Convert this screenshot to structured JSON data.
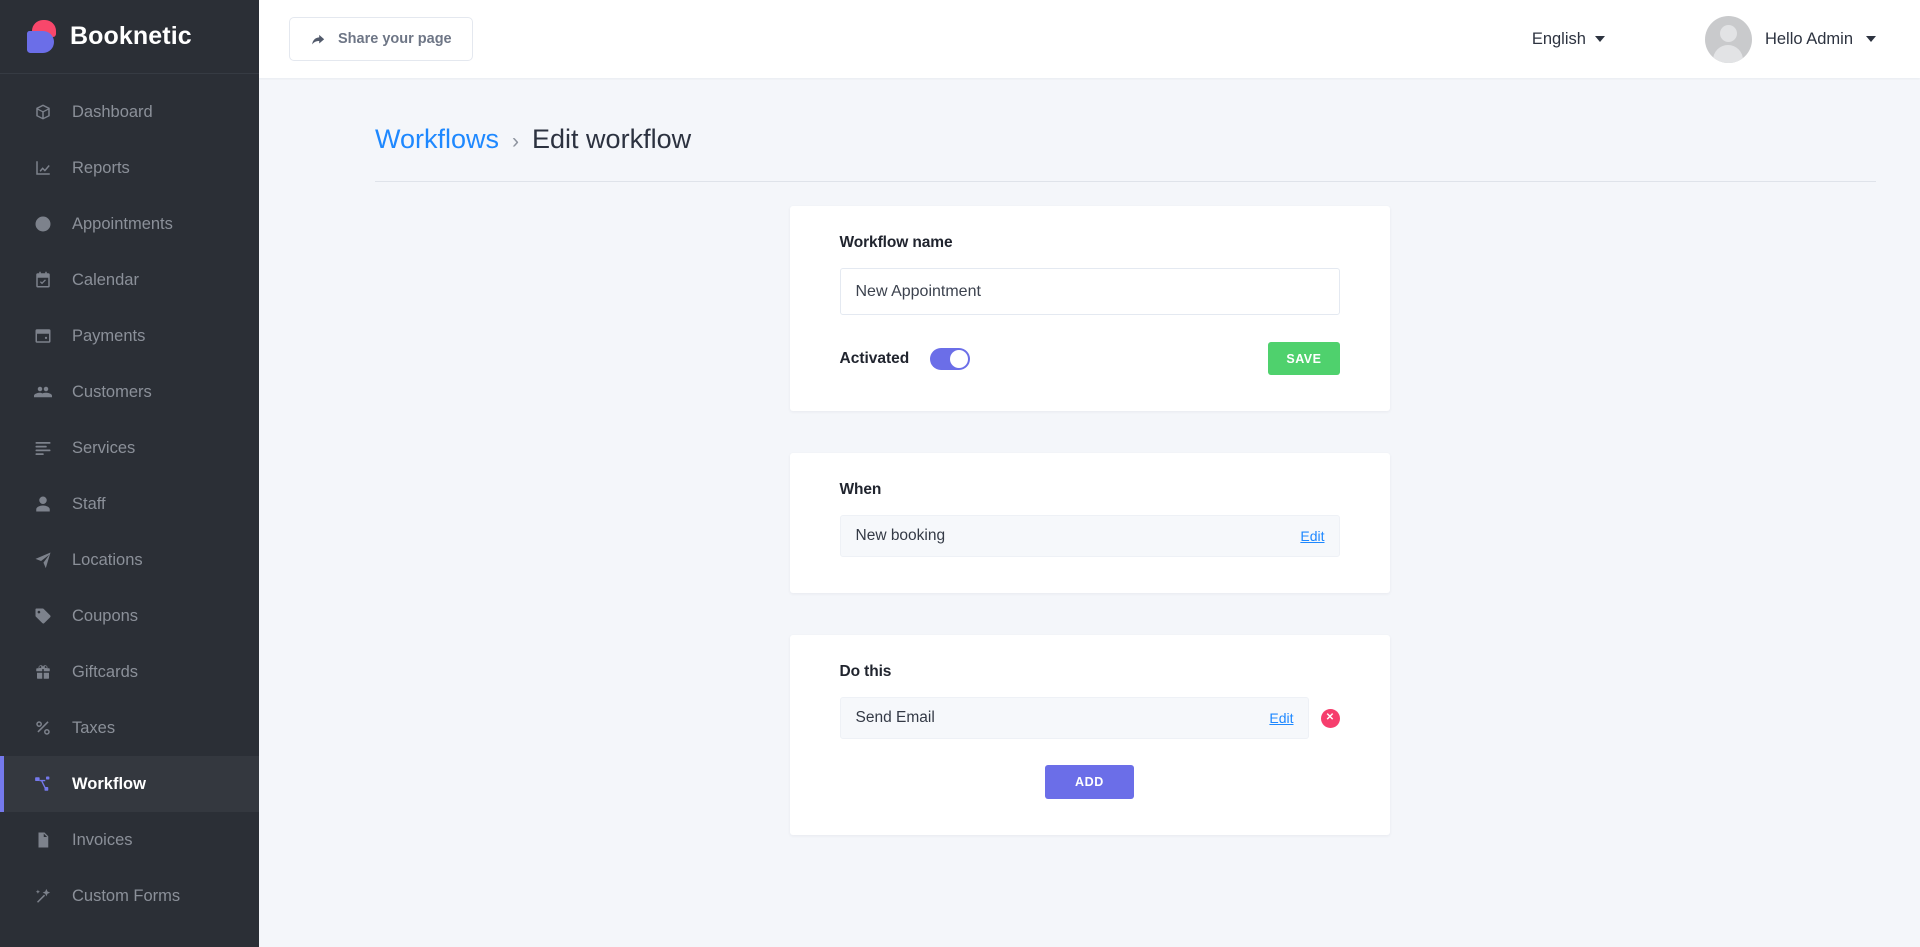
{
  "brand": {
    "name": "Booknetic",
    "logo_icon": "booknetic-b-logo"
  },
  "sidebar": {
    "items": [
      {
        "label": "Dashboard",
        "icon": "box-icon",
        "active": false
      },
      {
        "label": "Reports",
        "icon": "chart-icon",
        "active": false
      },
      {
        "label": "Appointments",
        "icon": "clock-icon",
        "active": false
      },
      {
        "label": "Calendar",
        "icon": "calendar-icon",
        "active": false
      },
      {
        "label": "Payments",
        "icon": "wallet-icon",
        "active": false
      },
      {
        "label": "Customers",
        "icon": "users-icon",
        "active": false
      },
      {
        "label": "Services",
        "icon": "list-icon",
        "active": false
      },
      {
        "label": "Staff",
        "icon": "user-icon",
        "active": false
      },
      {
        "label": "Locations",
        "icon": "send-icon",
        "active": false
      },
      {
        "label": "Coupons",
        "icon": "tag-icon",
        "active": false
      },
      {
        "label": "Giftcards",
        "icon": "gift-icon",
        "active": false
      },
      {
        "label": "Taxes",
        "icon": "percent-icon",
        "active": false
      },
      {
        "label": "Workflow",
        "icon": "workflow-icon",
        "active": true
      },
      {
        "label": "Invoices",
        "icon": "document-icon",
        "active": false
      },
      {
        "label": "Custom Forms",
        "icon": "magic-wand-icon",
        "active": false
      }
    ]
  },
  "topbar": {
    "share_label": "Share your page",
    "share_icon": "share-arrow-icon",
    "language": "English",
    "user_greeting": "Hello Admin",
    "avatar_icon": "user-avatar-placeholder"
  },
  "breadcrumb": {
    "parent": "Workflows",
    "separator": "›",
    "current": "Edit workflow"
  },
  "workflow_card": {
    "title": "Workflow name",
    "name_value": "New Appointment",
    "name_placeholder": "Workflow name",
    "activated_label": "Activated",
    "activated_on": true,
    "save_label": "SAVE"
  },
  "when_card": {
    "title": "When",
    "item_label": "New booking",
    "edit_label": "Edit"
  },
  "do_card": {
    "title": "Do this",
    "item_label": "Send Email",
    "edit_label": "Edit",
    "delete_icon": "close-circle-icon",
    "delete_glyph": "✕",
    "add_label": "ADD"
  },
  "colors": {
    "sidebar_bg": "#2b2f36",
    "sidebar_active_bg": "#34383f",
    "accent_purple": "#6b6ee8",
    "accent_green": "#4fd16d",
    "accent_red": "#f63e6d",
    "link_blue": "#1e88ff",
    "page_bg": "#f4f6fa",
    "logo_pink": "#f8476b"
  }
}
